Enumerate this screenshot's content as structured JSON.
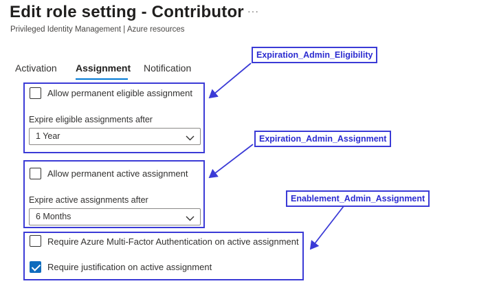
{
  "header": {
    "title": "Edit role setting - Contributor",
    "ellipsis": "···",
    "subtitle": "Privileged Identity Management | Azure resources"
  },
  "tabs": [
    {
      "label": "Activation",
      "active": false
    },
    {
      "label": "Assignment",
      "active": true
    },
    {
      "label": "Notification",
      "active": false
    }
  ],
  "eligible": {
    "permanent_label": "Allow permanent eligible assignment",
    "permanent_checked": false,
    "expire_label": "Expire eligible assignments after",
    "expire_value": "1 Year"
  },
  "active": {
    "permanent_label": "Allow permanent active assignment",
    "permanent_checked": false,
    "expire_label": "Expire active assignments after",
    "expire_value": "6 Months"
  },
  "enablement": {
    "mfa_label": "Require Azure Multi-Factor Authentication on active assignment",
    "mfa_checked": false,
    "justification_label": "Require justification on active assignment",
    "justification_checked": true
  },
  "callouts": {
    "eligibility": "Expiration_Admin_Eligibility",
    "assignment": "Expiration_Admin_Assignment",
    "enablement": "Enablement_Admin_Assignment"
  },
  "colors": {
    "accent": "#0078d4",
    "annotation": "#3a3ad6",
    "checkbox_checked": "#0f6cbd"
  },
  "icons": {
    "dropdown": "chevron-down-icon",
    "checkmark": "checkmark-icon",
    "more": "more-icon"
  }
}
